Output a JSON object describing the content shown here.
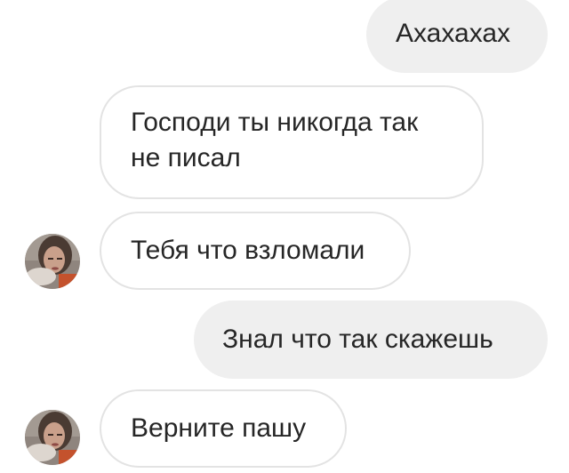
{
  "chat": {
    "messages": [
      {
        "direction": "outgoing",
        "text": "Ахахахах"
      },
      {
        "direction": "incoming",
        "lines": [
          "Господи ты никогда так",
          "не писал"
        ]
      },
      {
        "direction": "incoming",
        "text": "Тебя что взломали",
        "avatar": "user-avatar-photo"
      },
      {
        "direction": "outgoing",
        "text": "Знал что так скажешь"
      },
      {
        "direction": "incoming",
        "text": "Верните пашу",
        "avatar": "user-avatar-photo"
      }
    ]
  },
  "colors": {
    "outgoing_bubble": "#efefef",
    "incoming_border": "#e3e3e3",
    "text": "#262626"
  }
}
